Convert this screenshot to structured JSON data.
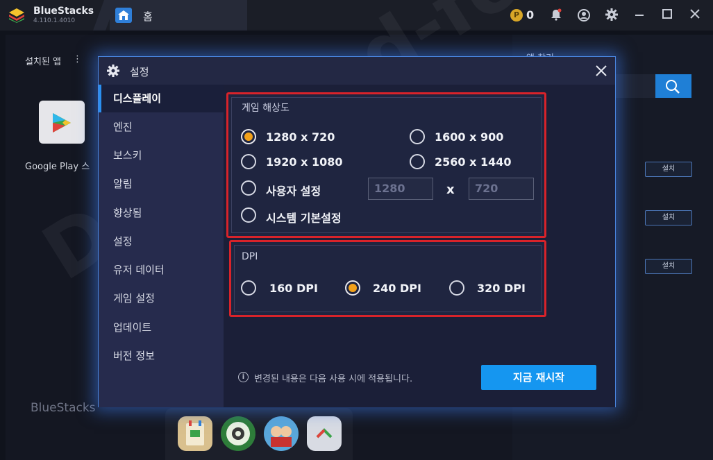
{
  "titlebar": {
    "app_name": "BlueStacks",
    "version": "4.110.1.4010",
    "home_tab_label": "홈",
    "coin_symbol": "P",
    "coins": "0",
    "icons": [
      "bell-icon",
      "account-icon",
      "gear-icon",
      "minimize-icon",
      "maximize-icon",
      "close-icon"
    ]
  },
  "background": {
    "installed_apps_label": "설치된 앱",
    "installed_menu": "⋮",
    "play_store_label": "Google Play 스",
    "brand_watermark": "BlueStacks",
    "right_panel_title": "앱 찾기",
    "install_buttons": [
      "설치",
      "설치",
      "설치"
    ],
    "overlay_watermark": "Download-forum"
  },
  "dialog": {
    "title": "설정",
    "sidebar": [
      {
        "label": "디스플레이",
        "active": true
      },
      {
        "label": "엔진",
        "active": false
      },
      {
        "label": "보스키",
        "active": false
      },
      {
        "label": "알림",
        "active": false
      },
      {
        "label": "향상됨",
        "active": false
      },
      {
        "label": "설정",
        "active": false
      },
      {
        "label": "유저 데이터",
        "active": false
      },
      {
        "label": "게임 설정",
        "active": false
      },
      {
        "label": "업데이트",
        "active": false
      },
      {
        "label": "버전 정보",
        "active": false
      }
    ],
    "resolution": {
      "title": "게임 해상도",
      "options": [
        "1280 x 720",
        "1600 x 900",
        "1920 x 1080",
        "2560 x 1440",
        "사용자 설정",
        "시스템 기본설정"
      ],
      "selected": "1280 x 720",
      "custom_width_placeholder": "1280",
      "custom_height_placeholder": "720",
      "custom_separator": "x"
    },
    "dpi": {
      "title": "DPI",
      "options": [
        "160 DPI",
        "240 DPI",
        "320 DPI"
      ],
      "selected": "240 DPI"
    },
    "info_icon": "i",
    "info_text": "변경된 내용은 다음 사용 시에 적용됩니다.",
    "restart_button": "지금 재시작"
  },
  "colors": {
    "accent": "#1596f0",
    "radio_selected": "#f2a11a",
    "highlight_border": "#d8232a",
    "dialog_glow": "#4a86e0"
  }
}
